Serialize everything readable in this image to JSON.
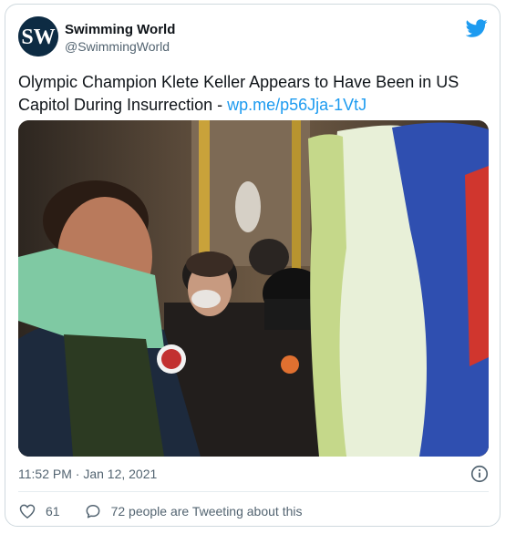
{
  "account": {
    "name": "Swimming World",
    "handle": "@SwimmingWorld",
    "avatar_letters": "SW"
  },
  "tweet": {
    "text": "Olympic Champion Klete Keller Appears to Have Been in US Capitol During Insurrection - ",
    "link": "wp.me/p56Jja-1VtJ"
  },
  "meta": {
    "timestamp": "11:52 PM · Jan 12, 2021"
  },
  "actions": {
    "likes": "61",
    "tweeting": "72 people are Tweeting about this"
  },
  "icons": {
    "brand": "twitter-bird-icon",
    "info": "info-icon",
    "like": "heart-icon",
    "reply": "speech-bubble-icon"
  },
  "colors": {
    "link": "#1d9bf0",
    "brand_blue": "#1d9bf0",
    "secondary_text": "#536471",
    "border": "#cfd9de"
  }
}
